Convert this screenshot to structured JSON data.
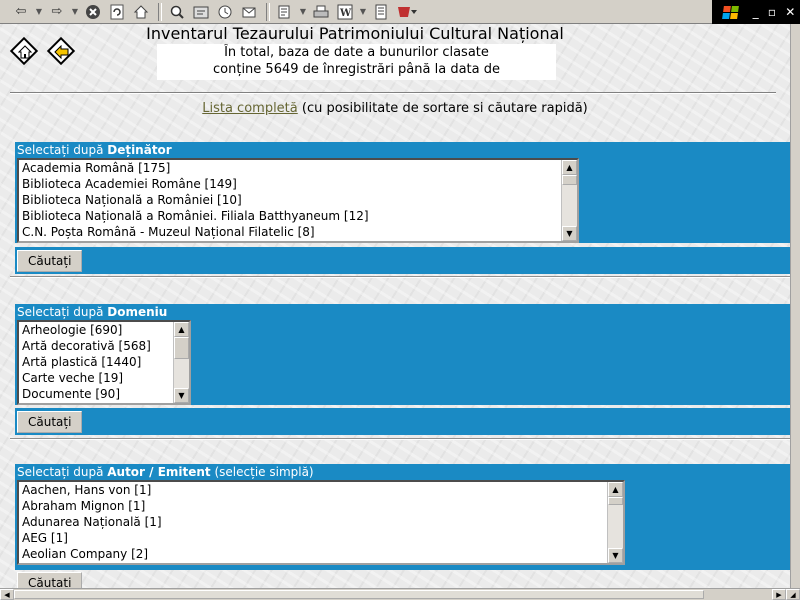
{
  "page": {
    "title": "Inventarul Tezaurului Patrimoniului Cultural Național",
    "summary_line1": "În total, baza de date a bunurilor clasate",
    "summary_line2": "conține 5649 de înregistrări până la data de",
    "full_list_link": "Lista completă",
    "full_list_note": " (cu posibilitate de sortare si căutare rapidă)"
  },
  "sections": [
    {
      "label_prefix": "Selectați după ",
      "label_bold": "Deținător",
      "label_extra": "",
      "items": [
        "Academia Română [175]",
        "Biblioteca Academiei Române [149]",
        "Biblioteca Națională a României [10]",
        "Biblioteca Națională a României. Filiala Batthyaneum [12]",
        "C.N. Poșta Română - Muzeul Național Filatelic [8]"
      ],
      "button": "Căutați"
    },
    {
      "label_prefix": "Selectați după ",
      "label_bold": "Domeniu",
      "label_extra": "",
      "items": [
        "Arheologie [690]",
        "Artă decorativă [568]",
        "Artă plastică [1440]",
        "Carte veche [19]",
        "Documente [90]"
      ],
      "button": "Căutați"
    },
    {
      "label_prefix": "Selectați după ",
      "label_bold": "Autor / Emitent",
      "label_extra": " (selecție simplă)",
      "items": [
        "Aachen, Hans von [1]",
        "Abraham Mignon [1]",
        "Adunarea Națională [1]",
        "AEG [1]",
        "Aeolian Company [2]"
      ],
      "button": "Căutați"
    }
  ],
  "colors": {
    "section_blue": "#1a8ac4",
    "link": "#666633"
  },
  "icons": [
    "back-icon",
    "forward-icon",
    "stop-icon",
    "refresh-icon",
    "home-icon",
    "search-icon",
    "favorites-icon",
    "history-icon",
    "edit-icon",
    "print-icon",
    "word-icon",
    "discuss-icon",
    "messenger-icon",
    "windows-logo-icon"
  ]
}
